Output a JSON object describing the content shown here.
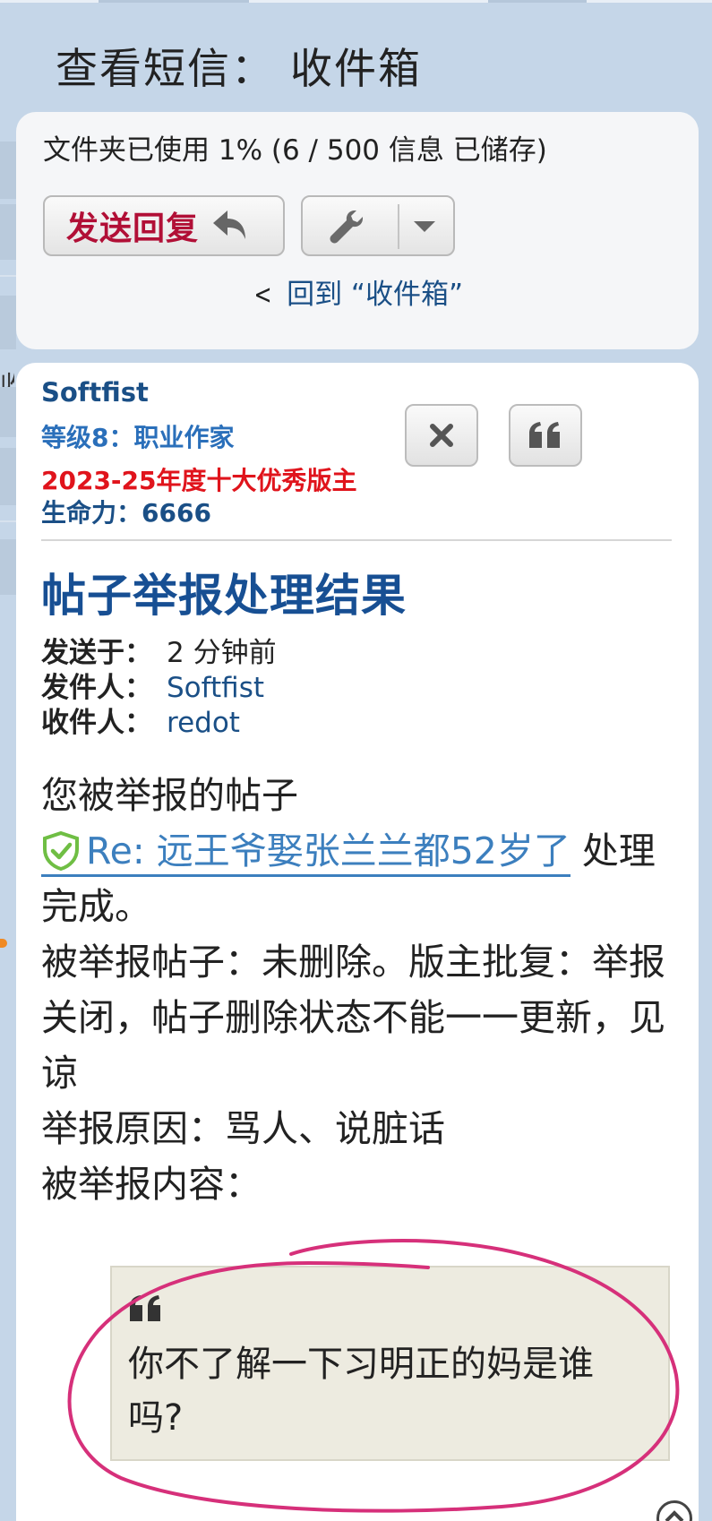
{
  "page": {
    "title": "查看短信： 收件箱"
  },
  "folder": {
    "usage_text": "文件夹已使用 1% (6 / 500 信息 已储存)",
    "reply_label": "发送回复",
    "back_link": "回到 “收件箱”"
  },
  "sidebar": {
    "partial_char": "收"
  },
  "message": {
    "author": {
      "name": "Softfist",
      "rank": "等级8：职业作家",
      "honor": "2023-25年度十大优秀版主",
      "vitality": "生命力：6666"
    },
    "title": "帖子举报处理结果",
    "sent_label": "发送于：",
    "sent_value": "2 分钟前",
    "from_label": "发件人：",
    "from_value": "Softfist",
    "to_label": "收件人：",
    "to_value": "redot",
    "body": {
      "line1": "您被举报的帖子",
      "post_link": "Re: 远王爷娶张兰兰都52岁了",
      "line2_tail": " 处理完成。",
      "line3": "被举报帖子：未删除。版主批复：举报关闭，帖子删除状态不能一一更新，见谅",
      "line4": "举报原因：骂人、说脏话",
      "line5": "被举报内容："
    },
    "quote": "你不了解一下习明正的妈是谁吗?"
  },
  "icons": [
    "reply-arrow-icon",
    "wrench-icon",
    "caret-down-icon",
    "chevron-left-icon",
    "close-icon",
    "quote-icon",
    "shield-check-icon",
    "scroll-top-icon"
  ],
  "colors": {
    "background": "#c5d6e8",
    "link": "#1a4f86",
    "reply_label": "#b10f36",
    "honor": "#e0141c",
    "title": "#174f93",
    "annotation": "#d6307a",
    "shield": "#6fbe44"
  }
}
